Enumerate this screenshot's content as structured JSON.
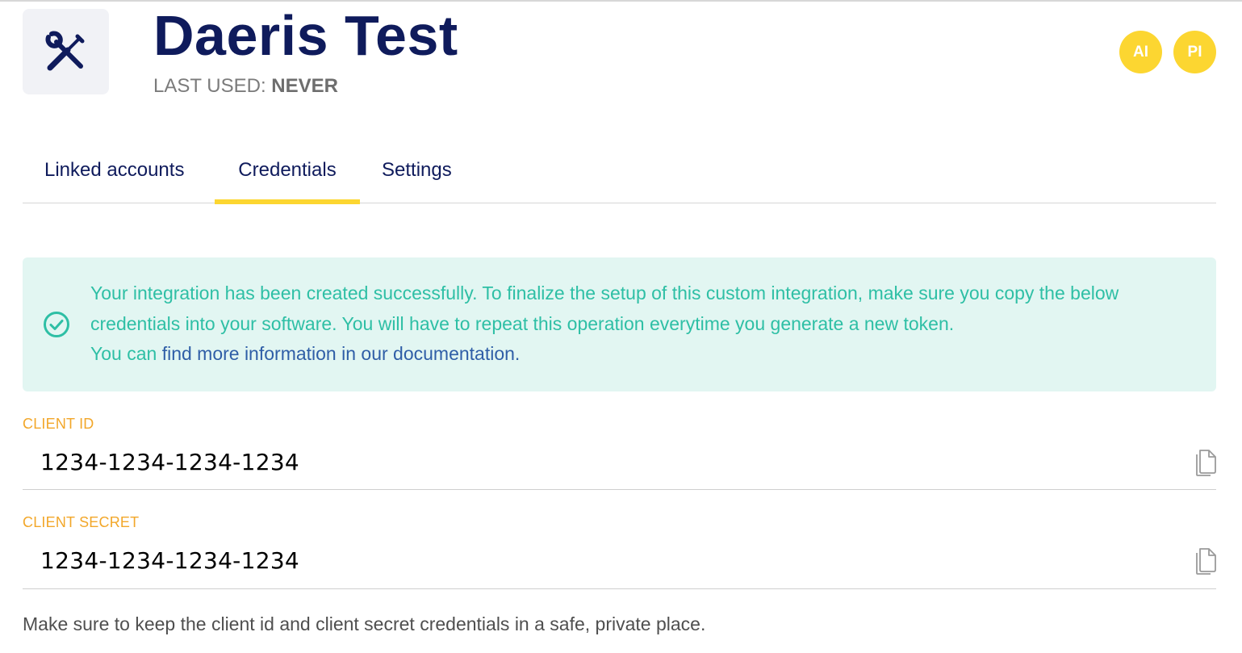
{
  "header": {
    "title": "Daeris Test",
    "last_used_label": "LAST USED:",
    "last_used_value": "NEVER",
    "app_icon": "tools-icon"
  },
  "avatars": [
    "AI",
    "PI"
  ],
  "tabs": [
    {
      "label": "Linked accounts",
      "active": false
    },
    {
      "label": "Credentials",
      "active": true
    },
    {
      "label": "Settings",
      "active": false
    }
  ],
  "alert": {
    "icon": "check-circle-icon",
    "text_main": "Your integration has been created successfully. To finalize the setup of this custom integration, make sure you copy the below credentials into your software. You will have to repeat this operation everytime you generate a new token.",
    "text_prefix": "You can ",
    "link_text": "find more information in our documentation."
  },
  "fields": [
    {
      "label": "CLIENT ID",
      "value": "1234-1234-1234-1234",
      "action_icon": "copy-icon"
    },
    {
      "label": "CLIENT SECRET",
      "value": "1234-1234-1234-1234",
      "action_icon": "copy-icon"
    }
  ],
  "footnote": "Make sure to keep the client id and client secret credentials in a safe, private place.",
  "colors": {
    "title": "#0f1b5c",
    "accent_yellow": "#fcd631",
    "alert_bg": "#e2f6f2",
    "alert_text": "#2ebfa5",
    "link": "#2f5ea7",
    "field_label": "#f2a72a"
  }
}
